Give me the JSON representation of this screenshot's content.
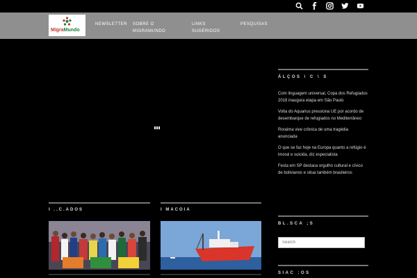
{
  "social": {
    "icons": [
      "search-icon",
      "facebook-icon",
      "instagram-icon",
      "twitter-icon",
      "youtube-icon"
    ]
  },
  "logo": {
    "text_part1": "Migra",
    "text_part2": "Mundo"
  },
  "nav": {
    "items": [
      "NEWSLETTER",
      "SOBRE O MIGRAMUNDO",
      "LINKS SUGERIDOS",
      "PESQUISAS"
    ]
  },
  "columns": [
    {
      "title": "I ..C.ADOS"
    },
    {
      "title": "I MACOIA"
    }
  ],
  "sidebar": {
    "recent_title": "ÁLÇOS \\ C \\ S",
    "news": [
      "Com linguagem universal, Copa dos Refugiados 2018 inaugura etapa em São Paulo",
      "Volta do Aquarius pressiona UE por acordo de desembarque de refugiados no Mediterrâneo",
      "Roraima vive crônica de uma tragédia anunciada",
      "O que se faz hoje na Europa quanto a refúgio é imoral e suicida, diz especialista",
      "Festa em SP destaca orgulho cultural e cívico de bolivianos e situa também brasileiros"
    ],
    "search_title": "BL.SCA ;S",
    "search_placeholder": "Search",
    "bottom_title": "SIAC :OS"
  },
  "colors": {
    "background": "#000000",
    "navbar": "#8f8f8f",
    "divider": "#777777"
  }
}
